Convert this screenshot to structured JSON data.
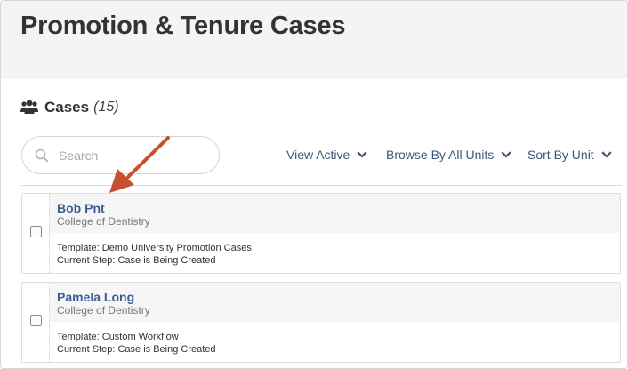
{
  "page": {
    "title": "Promotion & Tenure Cases"
  },
  "cases_header": {
    "label": "Cases",
    "count": "(15)",
    "icon": "users-icon"
  },
  "search": {
    "placeholder": "Search",
    "value": "",
    "icon": "search-icon"
  },
  "filters": [
    {
      "label": "View Active",
      "icon": "chevron-down-icon"
    },
    {
      "label": "Browse By All Units",
      "icon": "chevron-down-icon"
    },
    {
      "label": "Sort By Unit",
      "icon": "chevron-down-icon"
    }
  ],
  "cases": [
    {
      "name": "Bob Pnt",
      "unit": "College of Dentistry",
      "template": "Template: Demo University Promotion Cases",
      "step": "Current Step: Case is Being Created"
    },
    {
      "name": "Pamela Long",
      "unit": "College of Dentistry",
      "template": "Template: Custom Workflow",
      "step": "Current Step: Case is Being Created"
    }
  ],
  "colors": {
    "link": "#3b5f8f",
    "arrow": "#c8502e",
    "header_bg": "#f4f4f4"
  }
}
